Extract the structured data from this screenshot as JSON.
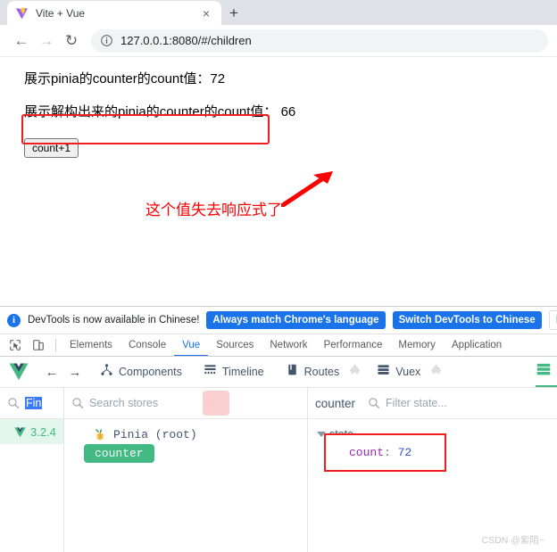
{
  "browser": {
    "tab": {
      "title": "Vite + Vue",
      "favicon": "vite-logo-icon",
      "close_label": "×"
    },
    "new_tab_label": "+",
    "nav": {
      "back": "←",
      "forward": "→",
      "reload": "↻"
    },
    "omnibox": {
      "url": "127.0.0.1:8080/#/children",
      "security_icon": "info-circle-icon"
    }
  },
  "page": {
    "line1": "展示pinia的counter的count值：72",
    "line2": "展示解构出来的pinia的counter的count值： 66",
    "button_label": "count+1",
    "annotation": "这个值失去响应式了",
    "annotation_color": "#ff0000",
    "highlight_color": "#ef1f1f"
  },
  "devtools": {
    "notice": {
      "text": "DevTools is now available in Chinese!",
      "primary_btn": "Always match Chrome's language",
      "secondary_btn": "Switch DevTools to Chinese",
      "tertiary_btn": "Don't s",
      "accent": "#1a73e8"
    },
    "tabs": [
      {
        "label": "Elements",
        "active": false
      },
      {
        "label": "Console",
        "active": false
      },
      {
        "label": "Vue",
        "active": true
      },
      {
        "label": "Sources",
        "active": false
      },
      {
        "label": "Network",
        "active": false
      },
      {
        "label": "Performance",
        "active": false
      },
      {
        "label": "Memory",
        "active": false
      },
      {
        "label": "Application",
        "active": false
      }
    ],
    "vue_toolbar": {
      "items": [
        {
          "label": "Components",
          "icon": "components-tree-icon"
        },
        {
          "label": "Timeline",
          "icon": "timeline-icon"
        },
        {
          "label": "Routes",
          "icon": "routes-book-icon"
        },
        {
          "label": "Vuex",
          "icon": "vuex-list-icon"
        }
      ],
      "accent": "#42b883"
    },
    "pinia": {
      "find_label": "Fin",
      "search_placeholder": "Search stores",
      "version": "3.2.4",
      "tree_root": "Pinia (root)",
      "selected_store": "counter",
      "detail_title": "counter",
      "filter_placeholder": "Filter state...",
      "state_label": "state",
      "state_entries": [
        {
          "key": "count",
          "value": "72"
        }
      ]
    }
  },
  "watermark": "CSDN @紫陌~"
}
